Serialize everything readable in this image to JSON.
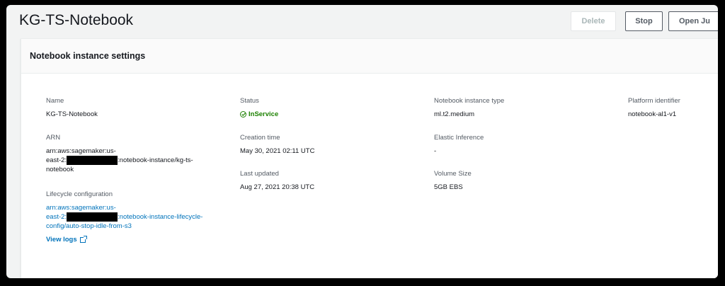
{
  "page": {
    "title": "KG-TS-Notebook"
  },
  "actions": {
    "delete": "Delete",
    "stop": "Stop",
    "open": "Open Ju"
  },
  "panel": {
    "heading": "Notebook instance settings",
    "name": {
      "label": "Name",
      "value": "KG-TS-Notebook"
    },
    "arn": {
      "label": "ARN",
      "line1": "arn:aws:sagemaker:us-",
      "line2_pre": "east-2:",
      "line2_post": ":notebook-instance/kg-ts-",
      "line3": "notebook"
    },
    "lifecycle": {
      "label": "Lifecycle configuration",
      "line1": "arn:aws:sagemaker:us-",
      "line2_pre": "east-2:",
      "line2_post": ":notebook-instance-lifecycle-",
      "line3": "config/auto-stop-idle-from-s3",
      "view_logs": "View logs"
    },
    "status": {
      "label": "Status",
      "value": "InService",
      "color": "#1d8102"
    },
    "creation_time": {
      "label": "Creation time",
      "value": "May 30, 2021 02:11 UTC"
    },
    "last_updated": {
      "label": "Last updated",
      "value": "Aug 27, 2021 20:38 UTC"
    },
    "instance_type": {
      "label": "Notebook instance type",
      "value": "ml.t2.medium"
    },
    "elastic_inference": {
      "label": "Elastic Inference",
      "value": "-"
    },
    "volume_size": {
      "label": "Volume Size",
      "value": "5GB EBS"
    },
    "platform": {
      "label": "Platform identifier",
      "value": "notebook-al1-v1"
    }
  }
}
